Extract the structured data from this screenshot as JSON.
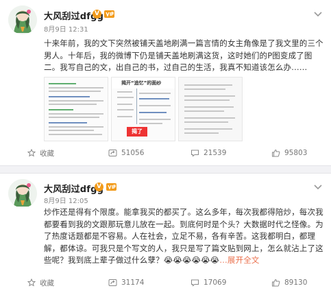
{
  "posts": [
    {
      "username": "大风刮过dfgg",
      "badge": "V",
      "time": "8月9日 12:31",
      "text": "十来年前，我的文下突然被铺天盖地刷满一篇言情的女主角像是了我文里的三个男人。十年后，我的微博下仍是铺天盖地刷满这货，这时她们的P图变成了图二。我写自己的文，出自己的书，过自己的生活，我真不知道该怎么办……",
      "actions": {
        "favorite": "收藏",
        "forward": "51056",
        "comment": "21539",
        "like": "95803"
      },
      "images": {
        "thumb2_title": "揭开“追忆”的面纱",
        "thumb2_stamp": "揭了"
      }
    },
    {
      "username": "大风刮过dfgg",
      "badge": "V",
      "time": "8月9日 12:05",
      "text": "炒作还是得有个限度。能拿我买的都买了。这么多年，每次我都得陪炒，每次我都要看到我的文跟那玩意儿放在一起。到底何时是个头？大数据时代之怪像。为了热度话题都是不容易。人在社会，立足不易，各有辛苦。这我都明白，都理解，都体谅。可我只是个写文的人，我只是写了篇文贴到网上，怎么就沾上了这些呢？我到底上辈子做过什么孽？😭😭😭😭😭😭",
      "expand": "…展开全文",
      "actions": {
        "favorite": "收藏",
        "forward": "31174",
        "comment": "17069",
        "like": "89130"
      }
    }
  ],
  "colors": {
    "accent_orange": "#f29b1b",
    "link": "#eb7350",
    "divider": "#f2f2f5"
  },
  "icons": [
    "avatar-illustration",
    "v-badge-icon",
    "vip-badge-icon",
    "chevron-down-icon",
    "star-icon",
    "forward-icon",
    "comment-icon",
    "like-icon"
  ]
}
